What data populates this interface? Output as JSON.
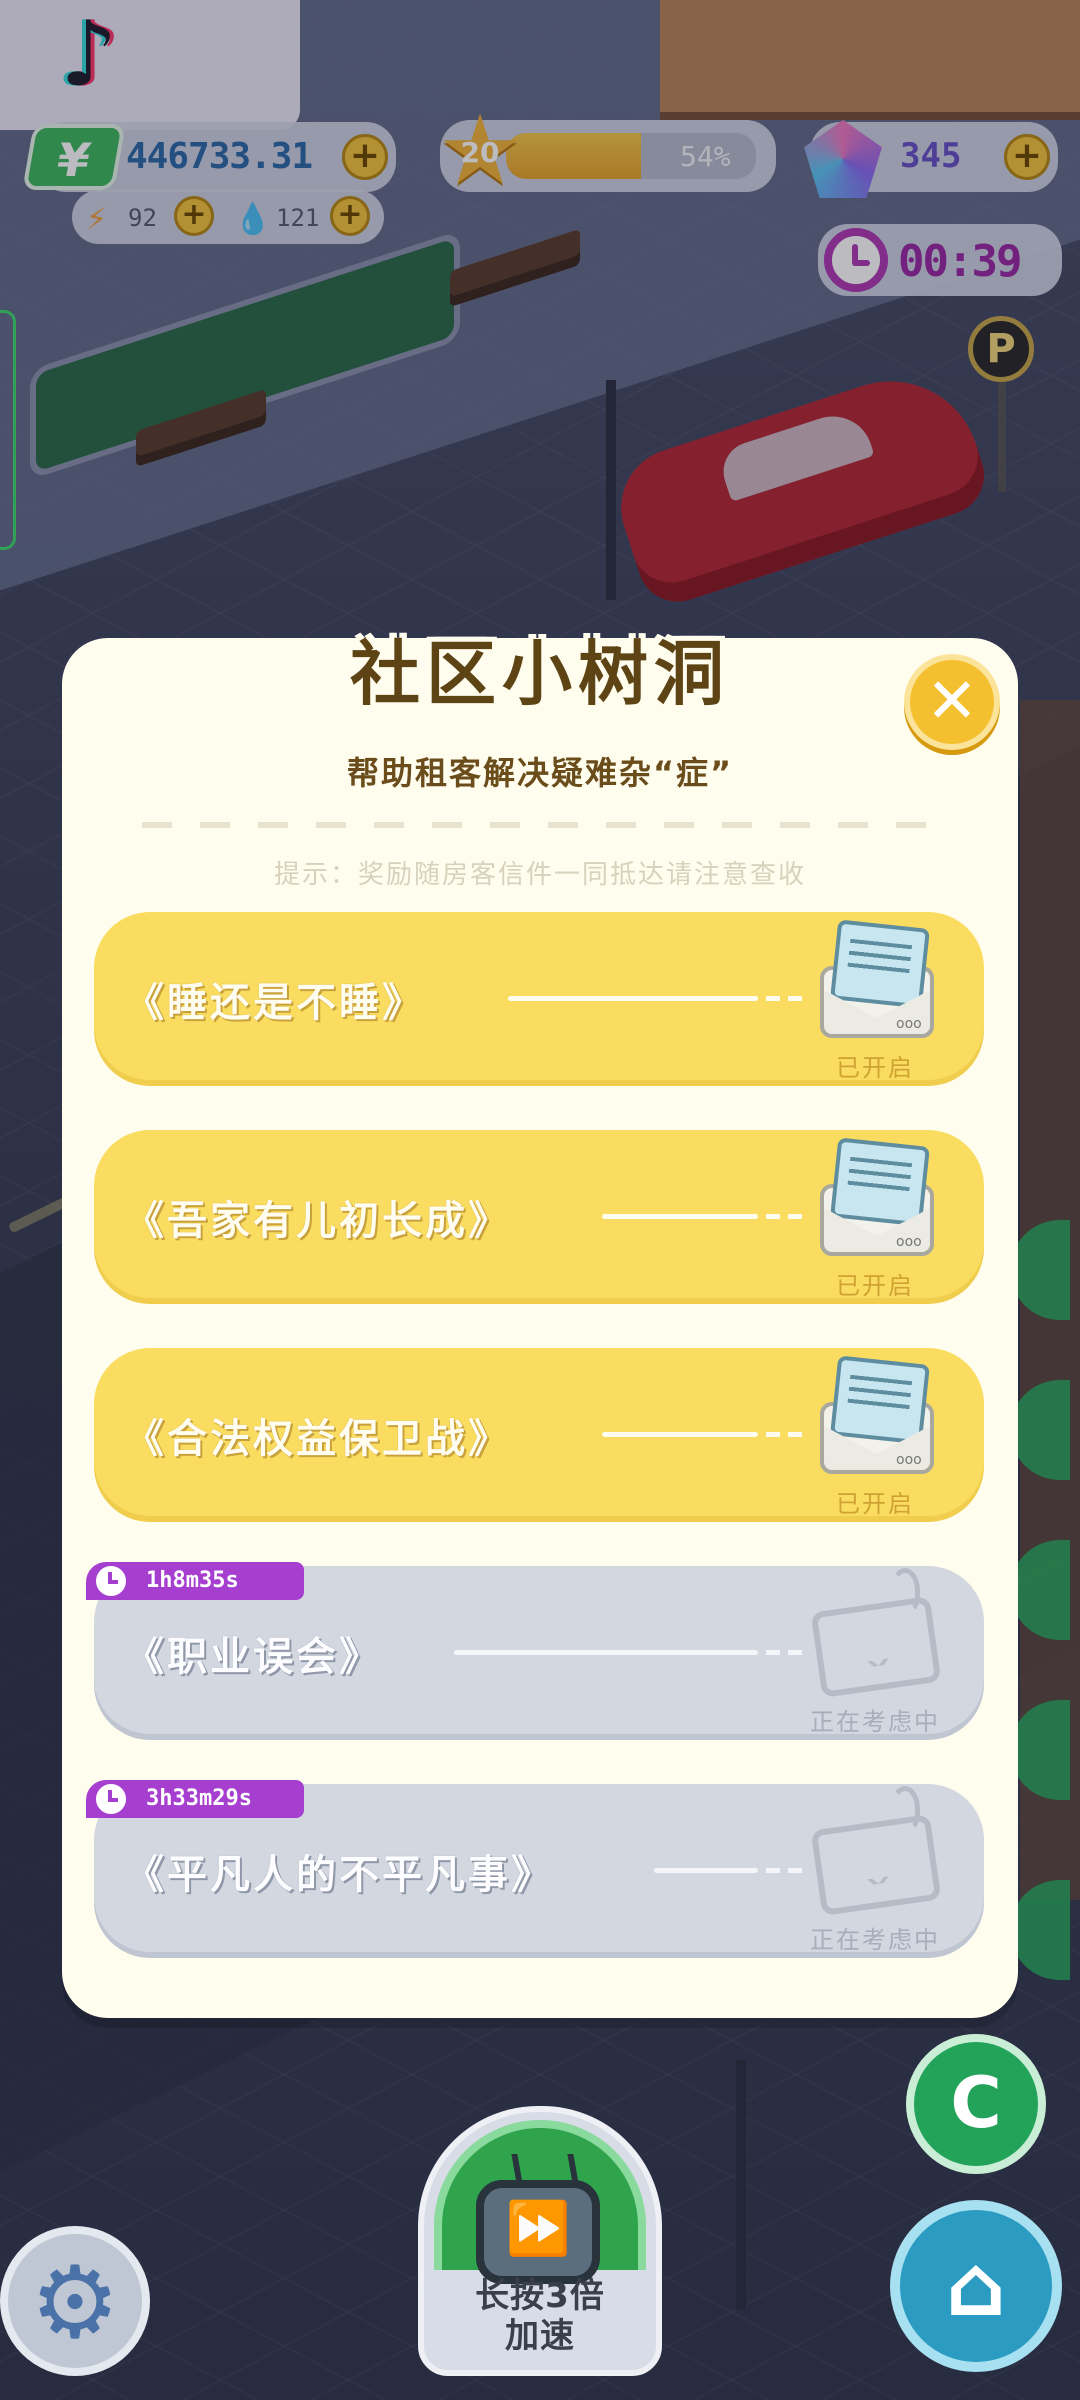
{
  "hud": {
    "money": "446733.31",
    "money_icon": "yuan-icon",
    "energy": "92",
    "water": "121",
    "level": "20",
    "level_progress_percent": 54,
    "level_progress_label": "54%",
    "gems": "345",
    "timer": "00:39",
    "plus_label": "+"
  },
  "modal": {
    "title": "社区小树洞",
    "subtitle": "帮助租客解决疑难杂“症”",
    "hint": "提示：奖励随房客信件一同抵达请注意查收",
    "close_label": "✕",
    "letters": [
      {
        "title": "《睡还是不睡》",
        "status": "已开启",
        "state": "open"
      },
      {
        "title": "《吾家有儿初长成》",
        "status": "已开启",
        "state": "open"
      },
      {
        "title": "《合法权益保卫战》",
        "status": "已开启",
        "state": "open"
      },
      {
        "title": "《职业误会》",
        "status": "正在考虑中",
        "state": "locked",
        "timer": "1h8m35s"
      },
      {
        "title": "《平凡人的不平凡事》",
        "status": "正在考虑中",
        "state": "locked",
        "timer": "3h33m29s"
      }
    ]
  },
  "controls": {
    "speed_label_line1": "长按3倍",
    "speed_label_line2": "加速",
    "share_label": "C",
    "home_label": "⌂"
  },
  "world": {
    "parking_sign": "P"
  },
  "colors": {
    "open_card": "#fadd60",
    "locked_card": "#d2d7e0",
    "timer_tag": "#a63fd0",
    "title": "#5e4414"
  }
}
